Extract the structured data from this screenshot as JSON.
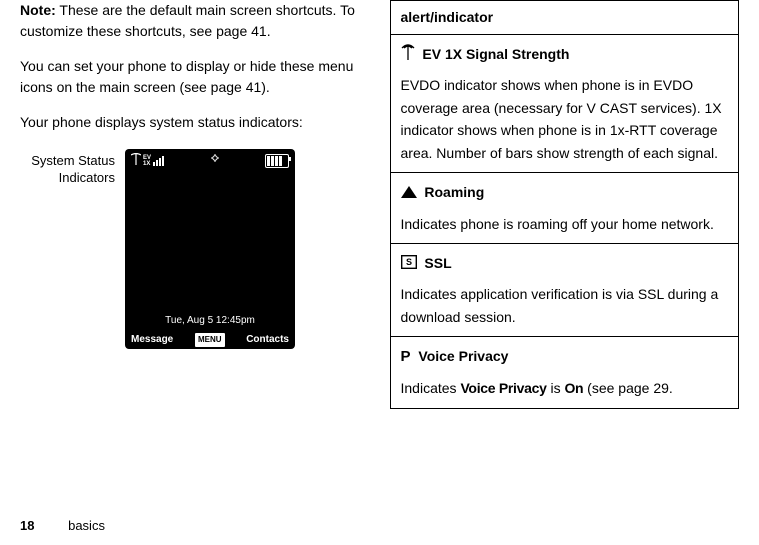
{
  "left": {
    "noteLabel": "Note:",
    "noteText": " These are the default main screen shortcuts. To customize these shortcuts, see page 41.",
    "para1": "You can set your phone to display or hide these menu icons on the main screen (see page 41).",
    "para2": "Your phone displays system status indicators:",
    "diagramLabel1": "System Status",
    "diagramLabel2": "Indicators",
    "phone": {
      "ev": "EV",
      "oneX": "1X",
      "date": "Tue, Aug 5  12:45pm",
      "leftKey": "Message",
      "menu": "MENU",
      "rightKey": "Contacts"
    }
  },
  "right": {
    "header": "alert/indicator",
    "rows": [
      {
        "title": "EV 1X  Signal Strength",
        "desc": "EVDO indicator shows when phone is in EVDO coverage area (necessary for V CAST services). 1X indicator shows when phone is in 1x-RTT coverage area. Number of bars show strength of each signal."
      },
      {
        "title": "Roaming",
        "desc": "Indicates phone is roaming off your home network."
      },
      {
        "title": "SSL",
        "desc": "Indicates application verification is via SSL during a download session."
      },
      {
        "title": "Voice Privacy",
        "descPrefix": "Indicates ",
        "voicePrivacy": "Voice Privacy",
        "is": " is ",
        "on": "On",
        "descSuffix": " (see page 29."
      }
    ]
  },
  "footer": {
    "pageNum": "18",
    "section": "basics"
  }
}
